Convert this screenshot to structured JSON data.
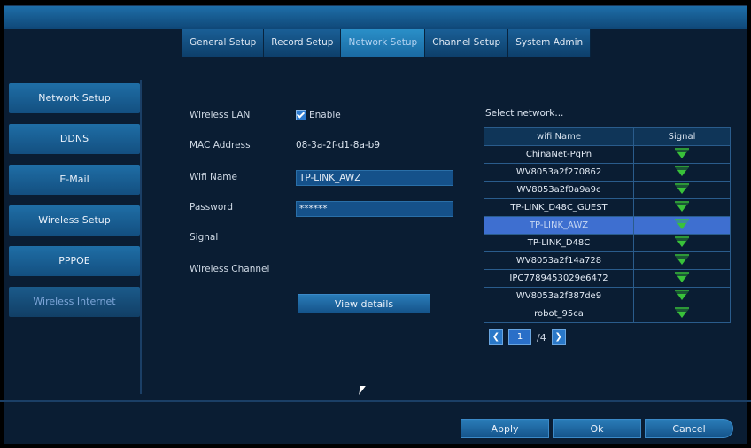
{
  "tabs": [
    {
      "label": "General Setup"
    },
    {
      "label": "Record Setup"
    },
    {
      "label": "Network Setup",
      "active": true
    },
    {
      "label": "Channel Setup"
    },
    {
      "label": "System Admin"
    }
  ],
  "sidebar": {
    "items": [
      {
        "label": "Network Setup"
      },
      {
        "label": "DDNS"
      },
      {
        "label": "E-Mail"
      },
      {
        "label": "Wireless Setup"
      },
      {
        "label": "PPPOE"
      },
      {
        "label": "Wireless Internet",
        "active": true
      }
    ]
  },
  "form": {
    "wireless_lan_label": "Wireless LAN",
    "enable_label": "Enable",
    "enable_checked": true,
    "mac_label": "MAC Address",
    "mac_value": "08-3a-2f-d1-8a-b9",
    "wifi_name_label": "Wifi Name",
    "wifi_name_value": "TP-LINK_AWZ",
    "password_label": "Password",
    "password_value": "******",
    "signal_label": "Signal",
    "channel_label": "Wireless Channel",
    "view_details": "View details"
  },
  "networks": {
    "heading": "Select network...",
    "columns": {
      "name": "wifi Name",
      "signal": "Signal"
    },
    "rows": [
      {
        "name": "ChinaNet-PqPn"
      },
      {
        "name": "WV8053a2f270862"
      },
      {
        "name": "WV8053a2f0a9a9c"
      },
      {
        "name": "TP-LINK_D48C_GUEST"
      },
      {
        "name": "TP-LINK_AWZ",
        "selected": true
      },
      {
        "name": "TP-LINK_D48C"
      },
      {
        "name": "WV8053a2f14a728"
      },
      {
        "name": "IPC7789453029e6472"
      },
      {
        "name": "WV8053a2f387de9"
      },
      {
        "name": "robot_95ca"
      }
    ]
  },
  "pager": {
    "current": "1",
    "total": "/4"
  },
  "footer": {
    "apply": "Apply",
    "ok": "Ok",
    "cancel": "Cancel"
  },
  "colors": {
    "signal": "#39c23a",
    "selected_row": "#3e6fd0",
    "accent": "#1e6ea8"
  }
}
